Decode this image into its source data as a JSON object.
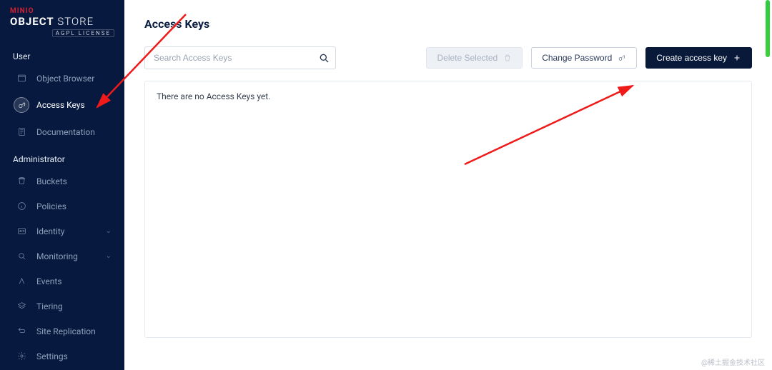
{
  "brand": {
    "line1": "MINIO",
    "line2a": "OBJECT",
    "line2b": "STORE",
    "license_badge": "AGPL LICENSE"
  },
  "sidebar": {
    "sections": [
      {
        "label": "User",
        "items": [
          {
            "key": "object-browser",
            "label": "Object Browser",
            "icon": "browser",
            "active": false
          },
          {
            "key": "access-keys",
            "label": "Access Keys",
            "icon": "key-badge",
            "active": true
          },
          {
            "key": "documentation",
            "label": "Documentation",
            "icon": "doc",
            "active": false
          }
        ]
      },
      {
        "label": "Administrator",
        "items": [
          {
            "key": "buckets",
            "label": "Buckets",
            "icon": "bucket"
          },
          {
            "key": "policies",
            "label": "Policies",
            "icon": "info"
          },
          {
            "key": "identity",
            "label": "Identity",
            "icon": "id",
            "expandable": true
          },
          {
            "key": "monitoring",
            "label": "Monitoring",
            "icon": "search",
            "expandable": true
          },
          {
            "key": "events",
            "label": "Events",
            "icon": "lambda"
          },
          {
            "key": "tiering",
            "label": "Tiering",
            "icon": "layers"
          },
          {
            "key": "site-replication",
            "label": "Site Replication",
            "icon": "replicate"
          },
          {
            "key": "settings",
            "label": "Settings",
            "icon": "gear"
          }
        ]
      }
    ]
  },
  "page": {
    "title": "Access Keys",
    "search_placeholder": "Search Access Keys",
    "empty_message": "There are no Access Keys yet."
  },
  "buttons": {
    "delete_selected": "Delete Selected",
    "change_password": "Change Password",
    "create_access_key": "Create access key"
  },
  "watermark": "@稀土掘金技术社区"
}
